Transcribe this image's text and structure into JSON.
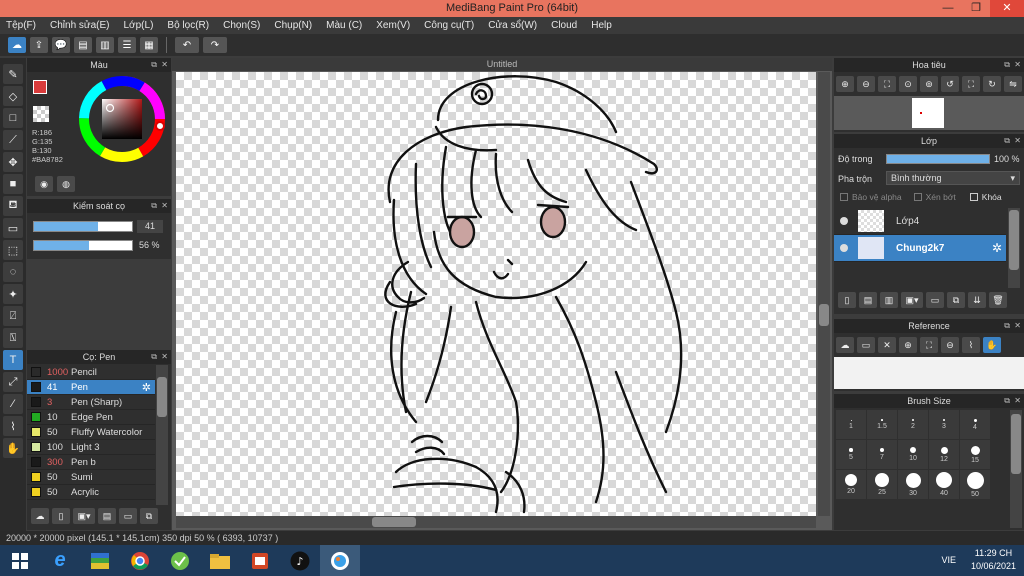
{
  "window": {
    "title": "MediBang Paint Pro (64bit)",
    "minimize": "—",
    "restore": "❐",
    "close": "✕"
  },
  "menu": [
    "Tệp(F)",
    "Chỉnh sửa(E)",
    "Lớp(L)",
    "Bộ lọc(R)",
    "Chọn(S)",
    "Chụp(N)",
    "Màu (C)",
    "Xem(V)",
    "Công cụ(T)",
    "Cửa sổ(W)",
    "Cloud",
    "Help"
  ],
  "canvas": {
    "tab_title": "Untitled"
  },
  "color_panel": {
    "title": "Màu",
    "r": "R:186",
    "g": "G:135",
    "b": "B:130",
    "hex": "#BA8782",
    "fg_color": "#d93b3b",
    "current_color": "#BA8782"
  },
  "brush_control": {
    "title": "Kiểm soát cọ",
    "size_value": "41",
    "opacity_value": "56 %",
    "size_fraction": 0.65,
    "opacity_fraction": 0.56
  },
  "brush_panel": {
    "title": "Cọ: Pen",
    "items": [
      {
        "size": "1000",
        "name": "Pencil",
        "color": "#2a2a2a",
        "size_color": "#e06060"
      },
      {
        "size": "41",
        "name": "Pen",
        "color": "#1a1a1a",
        "size_color": "#ffffff",
        "selected": true
      },
      {
        "size": "3",
        "name": "Pen (Sharp)",
        "color": "#1a1a1a",
        "size_color": "#e06060"
      },
      {
        "size": "10",
        "name": "Edge Pen",
        "color": "#22aa22",
        "size_color": "#dddddd"
      },
      {
        "size": "50",
        "name": "Fluffy Watercolor",
        "color": "#e8e86a",
        "size_color": "#dddddd"
      },
      {
        "size": "100",
        "name": "Light 3",
        "color": "#d6e8a0",
        "size_color": "#dddddd"
      },
      {
        "size": "300",
        "name": "Pen b",
        "color": "#1a1a1a",
        "size_color": "#e06060"
      },
      {
        "size": "50",
        "name": "Sumi",
        "color": "#f0d020",
        "size_color": "#dddddd"
      },
      {
        "size": "50",
        "name": "Acrylic",
        "color": "#f0d020",
        "size_color": "#dddddd"
      }
    ]
  },
  "navigator": {
    "title": "Hoa tiêu"
  },
  "layer_panel": {
    "title": "Lớp",
    "opacity_label": "Độ trong",
    "opacity_value": "100 %",
    "opacity_fraction": 1.0,
    "blend_label": "Pha trộn",
    "blend_value": "Bình thường",
    "protect_alpha": "Bảo vệ alpha",
    "clipping": "Xén bớt",
    "lock": "Khóa",
    "layers": [
      {
        "name": "Lớp4",
        "selected": false
      },
      {
        "name": "Chung2k7",
        "selected": true
      }
    ]
  },
  "reference_panel": {
    "title": "Reference"
  },
  "brush_size_panel": {
    "title": "Brush Size",
    "sizes": [
      "1",
      "1.5",
      "2",
      "3",
      "4",
      "5",
      "7",
      "10",
      "12",
      "15",
      "20",
      "25",
      "30",
      "40",
      "50"
    ]
  },
  "status": {
    "text": "20000 * 20000 pixel  (145.1 * 145.1cm)   350 dpi   50 %   ( 6393, 10737 )"
  },
  "taskbar": {
    "lang": "VIE",
    "time": "11:29 CH",
    "date": "10/06/2021"
  }
}
